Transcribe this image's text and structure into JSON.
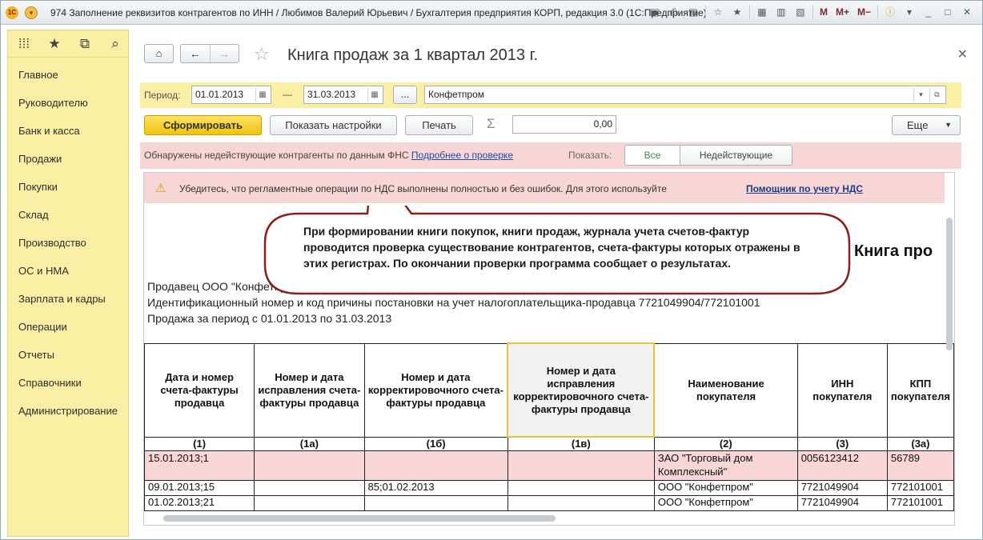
{
  "window": {
    "title": "974 Заполнение реквизитов контрагентов по ИНН / Любимов Валерий Юрьевич / Бухгалтерия предприятия КОРП, редакция 3.0 (1С:Предприятие)",
    "logo_text": "1С",
    "toolbar_m": "M",
    "toolbar_mplus": "M+",
    "toolbar_mminus": "M−"
  },
  "sidebar": {
    "items": [
      {
        "label": "Главное"
      },
      {
        "label": "Руководителю"
      },
      {
        "label": "Банк и касса"
      },
      {
        "label": "Продажи"
      },
      {
        "label": "Покупки"
      },
      {
        "label": "Склад"
      },
      {
        "label": "Производство"
      },
      {
        "label": "ОС и НМА"
      },
      {
        "label": "Зарплата и кадры"
      },
      {
        "label": "Операции"
      },
      {
        "label": "Отчеты"
      },
      {
        "label": "Справочники"
      },
      {
        "label": "Администрирование"
      }
    ]
  },
  "header": {
    "doc_title": "Книга продаж за 1 квартал 2013 г."
  },
  "period": {
    "label": "Период:",
    "from": "01.01.2013",
    "dash": "—",
    "to": "31.03.2013",
    "dots": "...",
    "org": "Конфетпром"
  },
  "actions": {
    "generate": "Сформировать",
    "settings": "Показать настройки",
    "print": "Печать",
    "sigma": "Σ",
    "sum": "0,00",
    "more": "Еще"
  },
  "warning": {
    "text": "Обнаружены недействующие контрагенты по данным ФНС",
    "link": "Подробнее о проверке",
    "show_label": "Показать:",
    "filter_all": "Все",
    "filter_inactive": "Недействующие"
  },
  "report": {
    "vat_notice": "Убедитесь, что регламентные операции по НДС выполнены полностью и без ошибок. Для этого используйте",
    "vat_link": "Помощник по учету НДС",
    "title": "Книга про",
    "seller": "Продавец  ООО \"Конфетпром\"",
    "inn_line": "Идентификационный номер и код причины постановки на учет налогоплательщика-продавца  7721049904/772101001",
    "period_line": "Продажа за период с 01.01.2013 по 31.03.2013",
    "columns": [
      "Дата и номер счета-фактуры продавца",
      "Номер и дата исправления счета-фактуры продавца",
      "Номер и дата корректировочного счета-фактуры продавца",
      "Номер и дата исправления корректировочного счета-фактуры продавца",
      "Наименование покупателя",
      "ИНН покупателя",
      "КПП покупателя"
    ],
    "column_numbers": [
      "(1)",
      "(1а)",
      "(1б)",
      "(1в)",
      "(2)",
      "(3)",
      "(3а)"
    ],
    "rows": [
      [
        "15.01.2013;1",
        "",
        "",
        "",
        "ЗАО \"Торговый дом Комплексный\"",
        "0056123412",
        "56789"
      ],
      [
        "09.01.2013;15",
        "",
        "85;01.02.2013",
        "",
        "ООО \"Конфетпром\"",
        "7721049904",
        "772101001"
      ],
      [
        "01.02.2013;21",
        "",
        "",
        "",
        "ООО \"Конфетпром\"",
        "7721049904",
        "772101001"
      ]
    ]
  },
  "callout": {
    "text": "При формировании книги покупок, книги продаж, журнала учета счетов-фактур проводится проверка существование контрагентов, счета-фактуры которых отражены в этих регистрах. По окончании проверки программа сообщает о результатах."
  }
}
